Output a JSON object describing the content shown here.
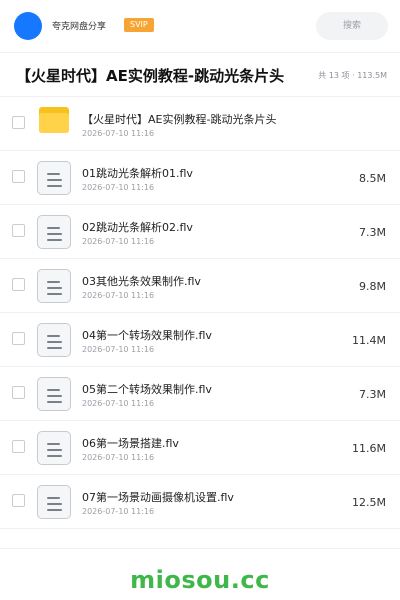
{
  "header": {
    "user_name": "夸克网盘分享",
    "badge": "SVIP",
    "search_placeholder": "搜索"
  },
  "folder": {
    "title": "【火星时代】AE实例教程-跳动光条片头",
    "meta": "共 13 项 · 113.5M"
  },
  "items": [
    {
      "type": "folder",
      "icon": "folder-icon",
      "name": "【火星时代】AE实例教程-跳动光条片头",
      "date": "2026-07-10 11:16",
      "size": ""
    },
    {
      "type": "file",
      "icon": "video-file-icon",
      "name": "01跳动光条解析01.flv",
      "date": "2026-07-10 11:16",
      "size": "8.5M"
    },
    {
      "type": "file",
      "icon": "video-file-icon",
      "name": "02跳动光条解析02.flv",
      "date": "2026-07-10 11:16",
      "size": "7.3M"
    },
    {
      "type": "file",
      "icon": "video-file-icon",
      "name": "03其他光条效果制作.flv",
      "date": "2026-07-10 11:16",
      "size": "9.8M"
    },
    {
      "type": "file",
      "icon": "video-file-icon",
      "name": "04第一个转场效果制作.flv",
      "date": "2026-07-10 11:16",
      "size": "11.4M"
    },
    {
      "type": "file",
      "icon": "video-file-icon",
      "name": "05第二个转场效果制作.flv",
      "date": "2026-07-10 11:16",
      "size": "7.3M"
    },
    {
      "type": "file",
      "icon": "video-file-icon",
      "name": "06第一场景搭建.flv",
      "date": "2026-07-10 11:16",
      "size": "11.6M"
    },
    {
      "type": "file",
      "icon": "video-file-icon",
      "name": "07第一场景动画摄像机设置.flv",
      "date": "2026-07-10 11:16",
      "size": "12.5M"
    }
  ],
  "watermark": "miosou.cc",
  "colors": {
    "accent_blue": "#1677ff",
    "svip_orange": "#f6a532",
    "folder_yellow": "#ffd24a",
    "watermark_green": "#3fb74a"
  }
}
